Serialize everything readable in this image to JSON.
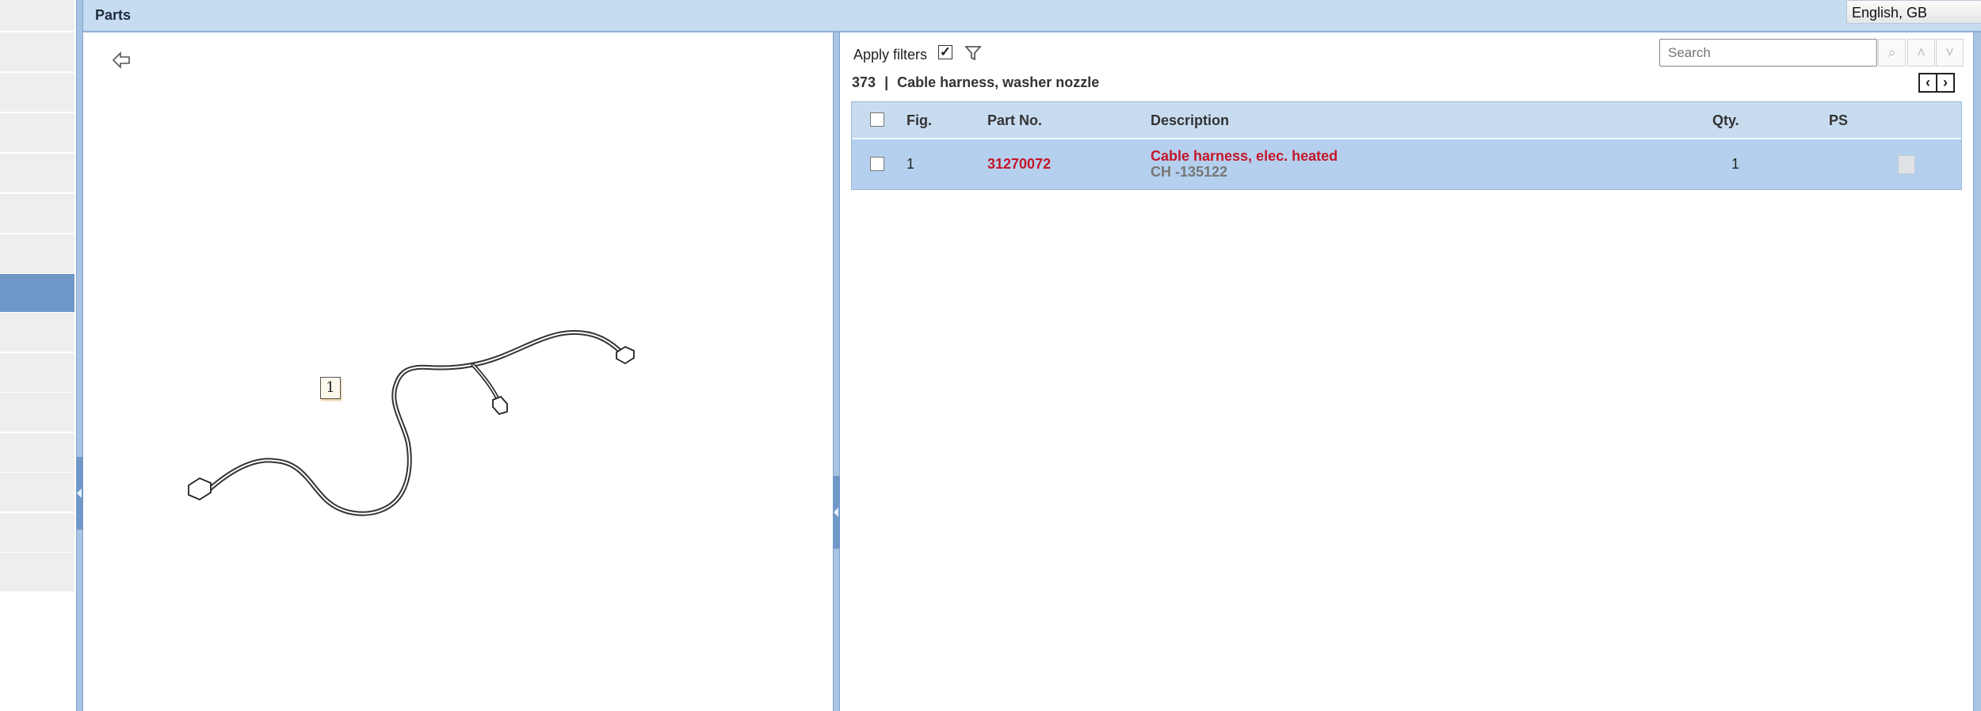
{
  "header": {
    "title": "Parts",
    "language": "English, GB"
  },
  "filters": {
    "label": "Apply filters",
    "checked": true
  },
  "search": {
    "placeholder": "Search"
  },
  "section": {
    "number": "373",
    "separator": "|",
    "title": "Cable harness, washer nozzle"
  },
  "table": {
    "columns": {
      "fig": "Fig.",
      "part_no": "Part No.",
      "description": "Description",
      "qty": "Qty.",
      "ps": "PS"
    },
    "rows": [
      {
        "fig": "1",
        "part_no": "31270072",
        "description": "Cable harness, elec. heated",
        "sub": "CH -135122",
        "qty": "1"
      }
    ]
  },
  "diagram": {
    "callout": "1"
  },
  "colors": {
    "header": "#c5dcf1",
    "selected": "#6f98c8",
    "row": "#b4d0ee",
    "part": "#c4162a"
  }
}
